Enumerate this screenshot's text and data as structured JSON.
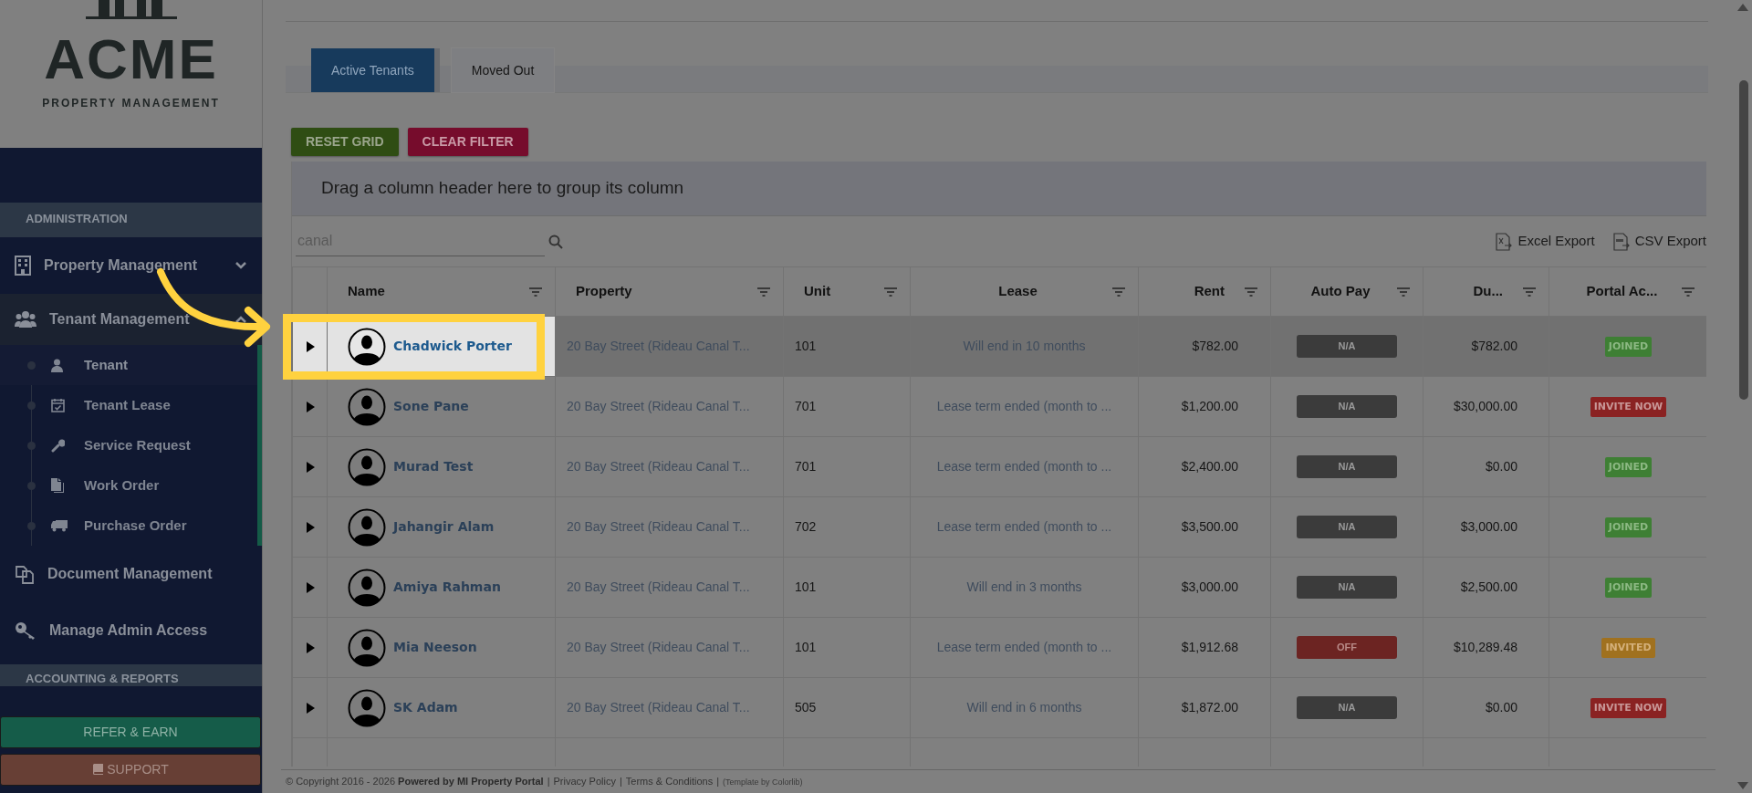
{
  "sidebar": {
    "logo": {
      "title": "ACME",
      "subtitle": "PROPERTY MANAGEMENT"
    },
    "sections": [
      {
        "title": "ADMINISTRATION",
        "items": [
          {
            "label": "Property Management",
            "expanded": false
          },
          {
            "label": "Tenant Management",
            "expanded": true,
            "children": [
              {
                "label": "Tenant",
                "selected": true
              },
              {
                "label": "Tenant Lease",
                "selected": false
              },
              {
                "label": "Service Request",
                "selected": false
              },
              {
                "label": "Work Order",
                "selected": false
              },
              {
                "label": "Purchase Order",
                "selected": false
              }
            ]
          },
          {
            "label": "Document Management"
          },
          {
            "label": "Manage Admin Access"
          }
        ]
      },
      {
        "title": "ACCOUNTING & REPORTS"
      }
    ],
    "buttons": [
      {
        "label": "REFER & EARN",
        "kind": "refer"
      },
      {
        "label": "SUPPORT",
        "kind": "support"
      }
    ]
  },
  "tabs": [
    {
      "label": "Active Tenants",
      "selected": true
    },
    {
      "label": "Moved Out",
      "selected": false
    }
  ],
  "actions": [
    {
      "label": "RESET GRID",
      "kind": "reset"
    },
    {
      "label": "CLEAR FILTER",
      "kind": "clear"
    }
  ],
  "group_panel": "Drag a column header here to group its column",
  "search": {
    "value": "canal"
  },
  "exports": [
    {
      "label": "Excel Export",
      "kind": "excel"
    },
    {
      "label": "CSV Export",
      "kind": "csv"
    }
  ],
  "table": {
    "columns": [
      {
        "label": "Name"
      },
      {
        "label": "Property"
      },
      {
        "label": "Unit"
      },
      {
        "label": "Lease"
      },
      {
        "label": "Rent"
      },
      {
        "label": "Auto Pay"
      },
      {
        "label": "Du..."
      },
      {
        "label": "Portal Ac..."
      }
    ],
    "rows": [
      {
        "selected": true,
        "name": "Chadwick Porter",
        "property": "20 Bay Street (Rideau Canal T...",
        "unit": "101",
        "lease": "Will end in 10 months",
        "rent": "$782.00",
        "auto_pay": {
          "text": "N/A",
          "kind": "na"
        },
        "due": "$782.00",
        "portal": {
          "text": "JOINED",
          "kind": "joined"
        }
      },
      {
        "selected": false,
        "name": "Sone Pane",
        "property": "20 Bay Street (Rideau Canal T...",
        "unit": "701",
        "lease": "Lease term ended (month to ...",
        "rent": "$1,200.00",
        "auto_pay": {
          "text": "N/A",
          "kind": "na"
        },
        "due": "$30,000.00",
        "portal": {
          "text": "INVITE NOW",
          "kind": "invite"
        }
      },
      {
        "selected": false,
        "name": "Murad Test",
        "property": "20 Bay Street (Rideau Canal T...",
        "unit": "701",
        "lease": "Lease term ended (month to ...",
        "rent": "$2,400.00",
        "auto_pay": {
          "text": "N/A",
          "kind": "na"
        },
        "due": "$0.00",
        "portal": {
          "text": "JOINED",
          "kind": "joined"
        }
      },
      {
        "selected": false,
        "name": "Jahangir Alam",
        "property": "20 Bay Street (Rideau Canal T...",
        "unit": "702",
        "lease": "Lease term ended (month to ...",
        "rent": "$3,500.00",
        "auto_pay": {
          "text": "N/A",
          "kind": "na"
        },
        "due": "$3,000.00",
        "portal": {
          "text": "JOINED",
          "kind": "joined"
        }
      },
      {
        "selected": false,
        "name": "Amiya Rahman",
        "property": "20 Bay Street (Rideau Canal T...",
        "unit": "101",
        "lease": "Will end in 3 months",
        "rent": "$3,000.00",
        "auto_pay": {
          "text": "N/A",
          "kind": "na"
        },
        "due": "$2,500.00",
        "portal": {
          "text": "JOINED",
          "kind": "joined"
        }
      },
      {
        "selected": false,
        "name": "Mia Neeson",
        "property": "20 Bay Street (Rideau Canal T...",
        "unit": "101",
        "lease": "Lease term ended (month to ...",
        "rent": "$1,912.68",
        "auto_pay": {
          "text": "OFF",
          "kind": "off"
        },
        "due": "$10,289.48",
        "portal": {
          "text": "INVITED",
          "kind": "invited"
        }
      },
      {
        "selected": false,
        "name": "SK Adam",
        "property": "20 Bay Street (Rideau Canal T...",
        "unit": "505",
        "lease": "Will end in 6 months",
        "rent": "$1,872.00",
        "auto_pay": {
          "text": "N/A",
          "kind": "na"
        },
        "due": "$0.00",
        "portal": {
          "text": "INVITE NOW",
          "kind": "invite"
        }
      }
    ]
  },
  "footer": {
    "copyright": "© Copyright 2016 - 2026 **Powered by MI Property Portal**",
    "separator": "|",
    "links": [
      "Privacy Policy",
      "Terms & Conditions"
    ],
    "credit": "(Template by Colorlib)"
  }
}
